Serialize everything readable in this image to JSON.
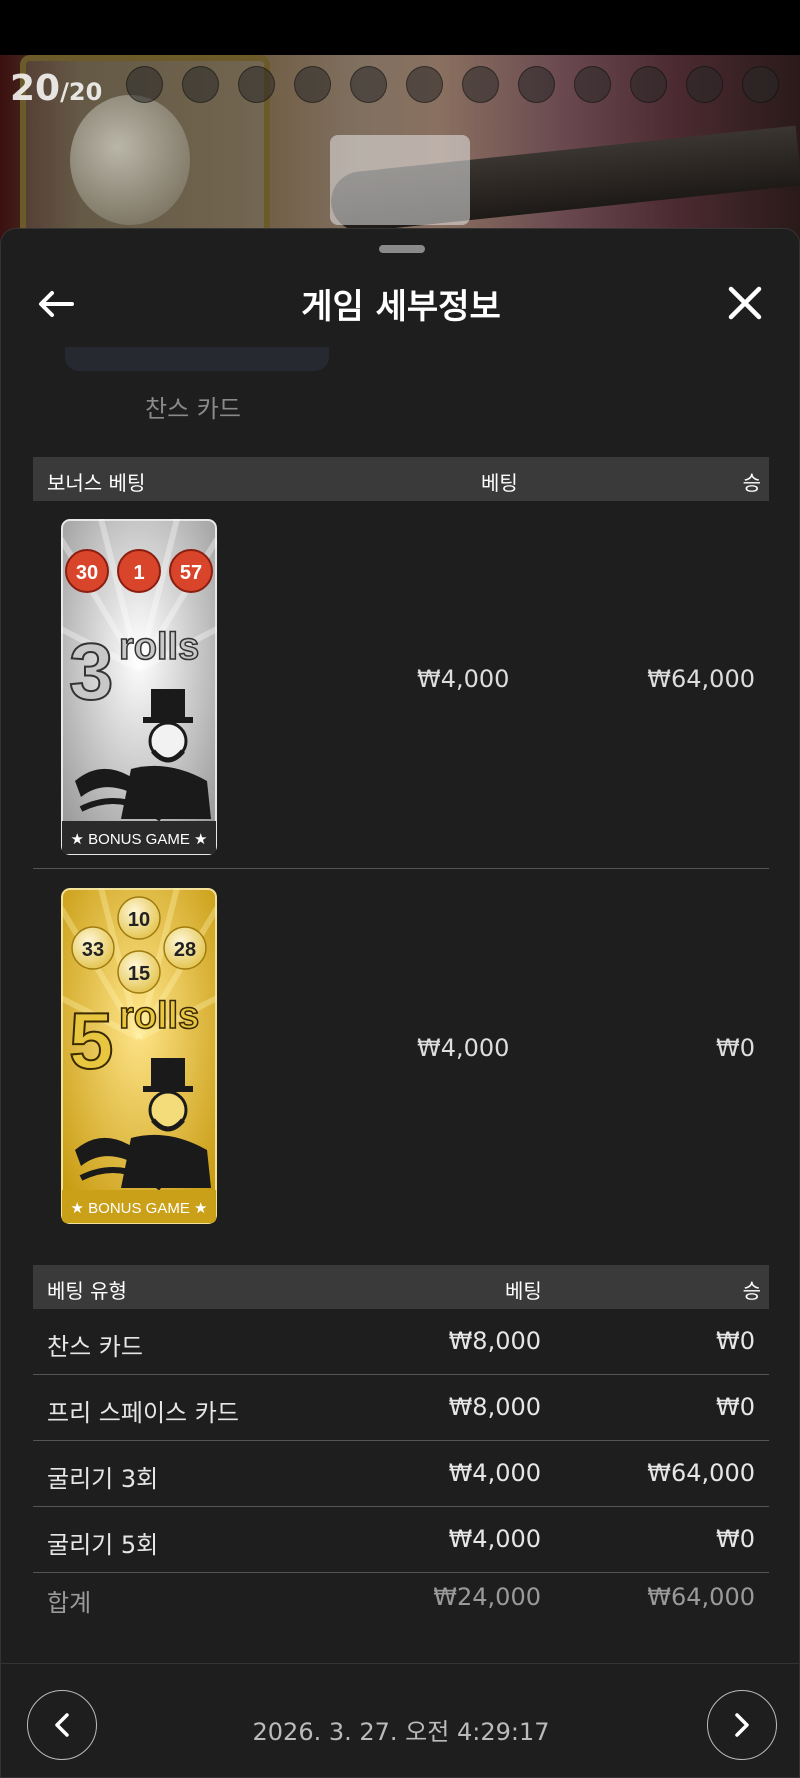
{
  "top": {
    "round_current": "20",
    "round_total": "/20"
  },
  "header": {
    "title": "게임 세부정보"
  },
  "previous_section": {
    "label": "찬스 카드"
  },
  "bonus_table": {
    "headers": [
      "보너스 베팅",
      "베팅",
      "승"
    ],
    "rows": [
      {
        "card": {
          "theme": "silver",
          "balls": [
            "30",
            "1",
            "57"
          ],
          "number": "3",
          "word": "rolls",
          "footer": "BONUS GAME"
        },
        "bet": "₩4,000",
        "win": "₩64,000"
      },
      {
        "card": {
          "theme": "gold",
          "balls": [
            "10",
            "33",
            "28",
            "15"
          ],
          "number": "5",
          "word": "rolls",
          "footer": "BONUS GAME"
        },
        "bet": "₩4,000",
        "win": "₩0"
      }
    ]
  },
  "bet_table": {
    "headers": [
      "베팅 유형",
      "베팅",
      "승"
    ],
    "rows": [
      {
        "type": "찬스 카드",
        "bet": "₩8,000",
        "win": "₩0"
      },
      {
        "type": "프리 스페이스 카드",
        "bet": "₩8,000",
        "win": "₩0"
      },
      {
        "type": "굴리기 3회",
        "bet": "₩4,000",
        "win": "₩64,000"
      },
      {
        "type": "굴리기 5회",
        "bet": "₩4,000",
        "win": "₩0"
      }
    ],
    "total": {
      "type": "합계",
      "bet": "₩24,000",
      "win": "₩64,000"
    }
  },
  "footer": {
    "datetime": "2026. 3. 27. 오전 4:29:17"
  },
  "colors": {
    "sheet_bg": "#1e1e1e",
    "table_header_bg": "#3a3a3a",
    "ball_red": "#d9452a",
    "card_gold": "#e0b321",
    "card_silver": "#cfcfcf"
  },
  "icons": [
    "back-arrow-icon",
    "close-icon",
    "chevron-left-icon",
    "chevron-right-icon"
  ]
}
